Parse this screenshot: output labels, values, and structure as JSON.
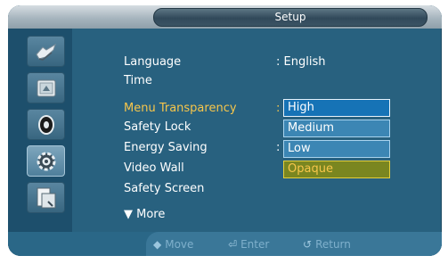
{
  "header": {
    "title": "Setup"
  },
  "sidebar": {
    "items": [
      {
        "icon": "picture-icon"
      },
      {
        "icon": "sound-icon"
      },
      {
        "icon": "pip-icon"
      },
      {
        "icon": "setup-gear-icon"
      },
      {
        "icon": "multi-control-icon"
      }
    ]
  },
  "menu": {
    "items": [
      {
        "label": "Language",
        "value": ": English"
      },
      {
        "label": "Time"
      },
      {
        "label": "Menu Transparency",
        "value": ":"
      },
      {
        "label": "Safety Lock"
      },
      {
        "label": "Energy Saving",
        "value": ":"
      },
      {
        "label": "Video Wall"
      },
      {
        "label": "Safety Screen"
      },
      {
        "label": "▼ More"
      }
    ]
  },
  "dropdown": {
    "options": [
      "High",
      "Medium",
      "Low",
      "Opaque"
    ],
    "highlighted": "High",
    "current": "Opaque"
  },
  "footer": {
    "move": "Move",
    "enter": "Enter",
    "return": "Return"
  },
  "colors": {
    "panel": "#28617f",
    "selected_text": "#f7c64b"
  }
}
